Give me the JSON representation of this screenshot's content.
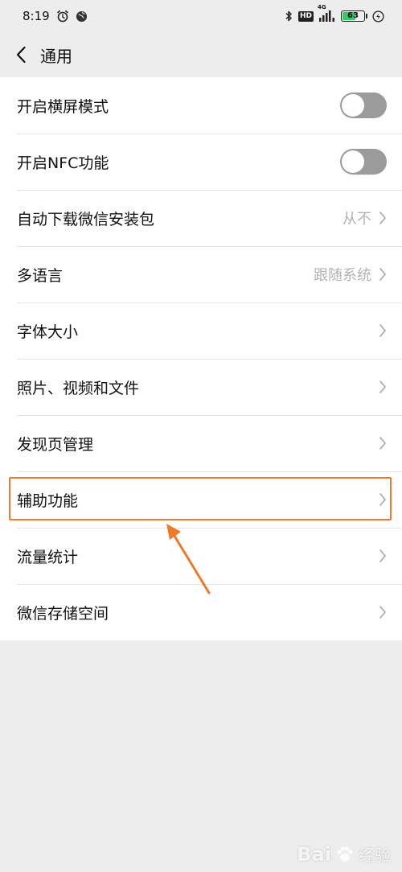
{
  "status_bar": {
    "time": "8:19",
    "battery_level": "63",
    "battery_color": "#3cc46a",
    "network": "4G",
    "hd_label": "HD",
    "icons": [
      "alarm-icon",
      "globe-icon",
      "bluetooth-icon",
      "hd-icon",
      "signal-icon",
      "battery-icon",
      "charging-icon"
    ]
  },
  "nav": {
    "title": "通用",
    "back_icon": "chevron-left-icon"
  },
  "settings": {
    "items": [
      {
        "label": "开启横屏模式",
        "control": "toggle",
        "on": false
      },
      {
        "label": "开启NFC功能",
        "control": "toggle",
        "on": false
      },
      {
        "label": "自动下载微信安装包",
        "value": "从不",
        "control": "chevron"
      },
      {
        "label": "多语言",
        "value": "跟随系统",
        "control": "chevron"
      },
      {
        "label": "字体大小",
        "control": "chevron"
      },
      {
        "label": "照片、视频和文件",
        "control": "chevron"
      },
      {
        "label": "发现页管理",
        "control": "chevron"
      },
      {
        "label": "辅助功能",
        "control": "chevron"
      },
      {
        "label": "流量统计",
        "control": "chevron"
      },
      {
        "label": "微信存储空间",
        "control": "chevron"
      }
    ]
  },
  "annotation": {
    "highlighted_item": "辅助功能",
    "color": "#f07a2a"
  },
  "watermark": {
    "brand": "Bai",
    "suffix": "经验"
  },
  "colors": {
    "background": "#ededed",
    "card": "#ffffff",
    "toggle_off": "#9b9b9b",
    "secondary_text": "#b2b2b2"
  }
}
